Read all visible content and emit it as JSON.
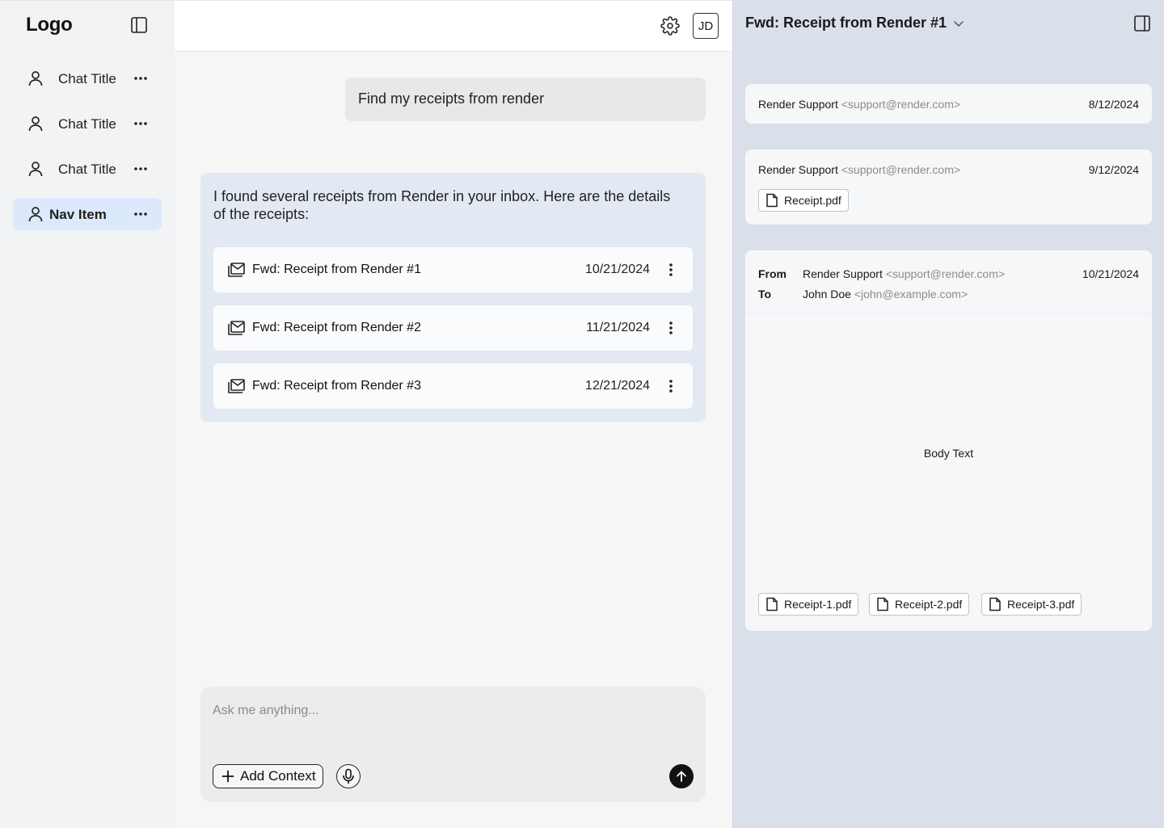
{
  "sidebar": {
    "logo": "Logo",
    "items": [
      {
        "label": "Chat Title"
      },
      {
        "label": "Chat Title"
      },
      {
        "label": "Chat Title"
      },
      {
        "label": "Nav Item",
        "active": true
      }
    ]
  },
  "header": {
    "avatar_initials": "JD"
  },
  "chat": {
    "user_message": "Find my receipts from render",
    "assistant_message": "I found several receipts from Render in your inbox. Here are the details of the receipts:",
    "results": [
      {
        "title": "Fwd: Receipt from Render #1",
        "date": "10/21/2024"
      },
      {
        "title": "Fwd: Receipt from Render #2",
        "date": "11/21/2024"
      },
      {
        "title": "Fwd: Receipt from Render #3",
        "date": "12/21/2024"
      }
    ]
  },
  "composer": {
    "placeholder": "Ask me anything...",
    "value": "",
    "add_context_label": "Add Context"
  },
  "panel": {
    "title": "Fwd: Receipt from Render #1",
    "thread": [
      {
        "sender": "Render Support",
        "email": "<support@render.com>",
        "date": "8/12/2024"
      },
      {
        "sender": "Render Support",
        "email": "<support@render.com>",
        "date": "9/12/2024",
        "attachment": "Receipt.pdf"
      }
    ],
    "open_message": {
      "from_label": "From",
      "to_label": "To",
      "from_name": "Render Support",
      "from_email": "<support@render.com>",
      "to_name": "John Doe",
      "to_email": "<john@example.com>",
      "date": "10/21/2024",
      "body": "Body Text",
      "attachments": [
        "Receipt-1.pdf",
        "Receipt-2.pdf",
        "Receipt-3.pdf"
      ]
    }
  },
  "icons": {
    "sidebar_toggle": "sidebar-panel-icon",
    "nav": "user-icon",
    "more": "more-horizontal-icon",
    "row_more": "more-vertical-icon",
    "mail": "mail-stack-icon",
    "settings": "gear-icon",
    "microphone": "microphone-icon",
    "send": "arrow-up-icon",
    "file": "file-icon"
  },
  "colors": {
    "sidebar_bg": "#f2f3f5",
    "active_nav_bg": "#dce8fb",
    "assistant_bg": "#e2e9f3",
    "panel_bg": "#d9e0ea",
    "send_button": "#111111"
  }
}
